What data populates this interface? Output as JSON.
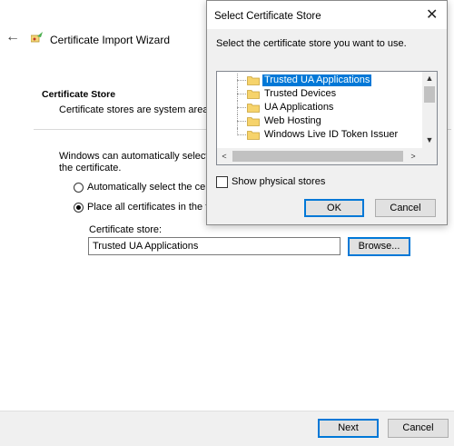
{
  "wizard": {
    "title": "Certificate Import Wizard",
    "section_heading": "Certificate Store",
    "section_description": "Certificate stores are system areas",
    "auto_select_text": "Windows can automatically select a the certificate.",
    "radio_auto_label": "Automatically select the certifi",
    "radio_place_label": "Place all certificates in the foll",
    "selected_radio": "place",
    "store_label": "Certificate store:",
    "store_value": "Trusted UA Applications",
    "browse_label": "Browse...",
    "next_label": "Next",
    "cancel_label": "Cancel",
    "icons": {
      "back": "back-arrow-icon",
      "wizard": "certificate-wizard-icon"
    }
  },
  "dialog": {
    "title": "Select Certificate Store",
    "close_glyph": "✕",
    "instruction": "Select the certificate store you want to use.",
    "stores": [
      {
        "label": "Trusted UA Applications",
        "selected": true
      },
      {
        "label": "Trusted Devices",
        "selected": false
      },
      {
        "label": "UA Applications",
        "selected": false
      },
      {
        "label": "Web Hosting",
        "selected": false
      },
      {
        "label": "Windows Live ID Token Issuer",
        "selected": false
      }
    ],
    "show_physical_label": "Show physical stores",
    "show_physical_checked": false,
    "ok_label": "OK",
    "cancel_label": "Cancel",
    "scroll_glyphs": {
      "up": "▲",
      "down": "▼",
      "left": "<",
      "right": ">"
    }
  },
  "colors": {
    "accent": "#0078d7",
    "folder": "#f6d36b",
    "footer": "#f0f0f0"
  }
}
